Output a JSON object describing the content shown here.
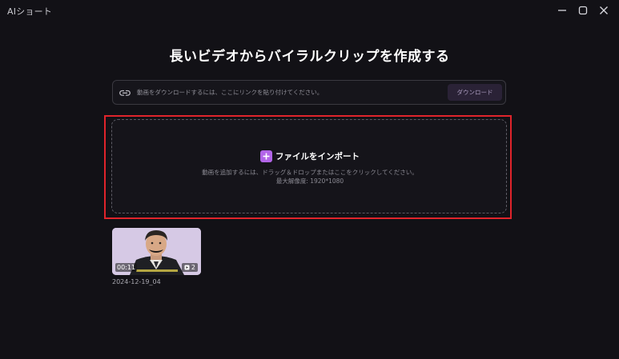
{
  "window": {
    "title": "AIショート"
  },
  "main": {
    "headline": "長いビデオからバイラルクリップを作成する",
    "url_input": {
      "placeholder": "動画をダウンロードするには、ここにリンクを貼り付けてください。",
      "value": ""
    },
    "download_label": "ダウンロード",
    "drop_zone": {
      "import_label": "ファイルをインポート",
      "hint": "動画を追加するには、ドラッグ＆ドロップまたはここをクリックしてください。",
      "max_resolution": "最大解像度: 1920*1080"
    }
  },
  "videos": [
    {
      "name": "2024-12-19_04",
      "duration": "00:11",
      "clip_count": "2"
    }
  ],
  "colors": {
    "background": "#121116",
    "accent": "#b265e8",
    "highlight": "#e0242b",
    "download_button": "#2a2236"
  },
  "icons": [
    "minimize-icon",
    "maximize-icon",
    "close-icon",
    "link-icon",
    "plus-icon",
    "clip-icon"
  ]
}
